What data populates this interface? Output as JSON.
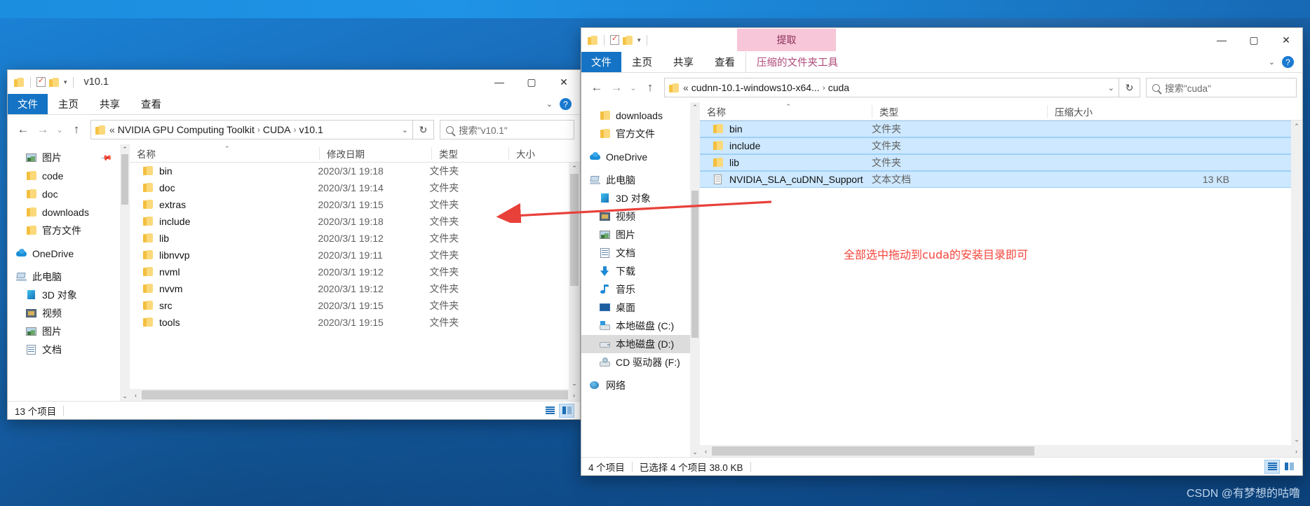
{
  "desktop": {
    "watermark": "CSDN @有梦想的咕噜",
    "annotation": "全部选中拖动到cuda的安装目录即可",
    "accent_blue": "#1473c4",
    "selection_blue": "#cde8ff",
    "annotation_red": "#f5453c",
    "contextual_tab_pink": "#f7c6d8"
  },
  "left_window": {
    "title": "v10.1",
    "quick_access": {
      "folder_icon": "folder-icon",
      "properties_icon": "properties-icon",
      "new_folder_icon": "new-folder-icon",
      "customize_caret": "▾"
    },
    "window_controls": {
      "minimize": "—",
      "maximize": "▢",
      "close": "✕"
    },
    "ribbon_tabs": [
      "文件",
      "主页",
      "共享",
      "查看"
    ],
    "ribbon_right": {
      "collapse_caret": "⌄",
      "help": "?"
    },
    "address": {
      "back": "←",
      "forward": "→",
      "recent": "⌄",
      "up": "↑",
      "folder_icon": "folder-icon",
      "chevron_prefix": "«",
      "crumbs": [
        "NVIDIA GPU Computing Toolkit",
        "CUDA",
        "v10.1"
      ],
      "crumb_sep": "›",
      "dropdown_caret": "⌄",
      "refresh": "↻"
    },
    "search": {
      "icon": "search-icon",
      "placeholder": "搜索\"v10.1\"",
      "value": ""
    },
    "nav_pane": [
      {
        "label": "图片",
        "icon": "pictures-icon",
        "indent": true,
        "pinned": true
      },
      {
        "label": "code",
        "icon": "folder-icon",
        "indent": true
      },
      {
        "label": "doc",
        "icon": "folder-icon",
        "indent": true
      },
      {
        "label": "downloads",
        "icon": "folder-icon",
        "indent": true
      },
      {
        "label": "官方文件",
        "icon": "folder-icon",
        "indent": true
      },
      {
        "label": "OneDrive",
        "icon": "onedrive-icon",
        "indent": false
      },
      {
        "label": "此电脑",
        "icon": "this-pc-icon",
        "indent": false
      },
      {
        "label": "3D 对象",
        "icon": "3d-objects-icon",
        "indent": true
      },
      {
        "label": "视频",
        "icon": "videos-icon",
        "indent": true
      },
      {
        "label": "图片",
        "icon": "pictures-icon",
        "indent": true
      },
      {
        "label": "文档",
        "icon": "documents-icon",
        "indent": true
      }
    ],
    "columns": [
      "名称",
      "修改日期",
      "类型",
      "大小"
    ],
    "rows": [
      {
        "name": "bin",
        "date": "2020/3/1 19:18",
        "type": "文件夹",
        "size": ""
      },
      {
        "name": "doc",
        "date": "2020/3/1 19:14",
        "type": "文件夹",
        "size": ""
      },
      {
        "name": "extras",
        "date": "2020/3/1 19:15",
        "type": "文件夹",
        "size": ""
      },
      {
        "name": "include",
        "date": "2020/3/1 19:18",
        "type": "文件夹",
        "size": ""
      },
      {
        "name": "lib",
        "date": "2020/3/1 19:12",
        "type": "文件夹",
        "size": ""
      },
      {
        "name": "libnvvp",
        "date": "2020/3/1 19:11",
        "type": "文件夹",
        "size": ""
      },
      {
        "name": "nvml",
        "date": "2020/3/1 19:12",
        "type": "文件夹",
        "size": ""
      },
      {
        "name": "nvvm",
        "date": "2020/3/1 19:12",
        "type": "文件夹",
        "size": ""
      },
      {
        "name": "src",
        "date": "2020/3/1 19:15",
        "type": "文件夹",
        "size": ""
      },
      {
        "name": "tools",
        "date": "2020/3/1 19:15",
        "type": "文件夹",
        "size": ""
      }
    ],
    "status": {
      "count": "13 个项目",
      "selection": ""
    },
    "view_toggles": {
      "details": "details-view-icon",
      "tiles": "tiles-view-icon",
      "active": "tiles"
    }
  },
  "right_window": {
    "title": "cuda",
    "contextual_tab_banner": "提取",
    "quick_access": {
      "folder_icon": "folder-icon",
      "properties_icon": "properties-icon",
      "new_folder_icon": "new-folder-icon",
      "customize_caret": "▾"
    },
    "window_controls": {
      "minimize": "—",
      "maximize": "▢",
      "close": "✕"
    },
    "ribbon_tabs": [
      "文件",
      "主页",
      "共享",
      "查看"
    ],
    "contextual_tab": "压缩的文件夹工具",
    "ribbon_right": {
      "collapse_caret": "⌄",
      "help": "?"
    },
    "address": {
      "back": "←",
      "forward": "→",
      "recent": "⌄",
      "up": "↑",
      "folder_icon": "folder-icon",
      "chevron_prefix": "«",
      "crumbs": [
        "cudnn-10.1-windows10-x64...",
        "cuda"
      ],
      "crumb_sep": "›",
      "dropdown_caret": "⌄",
      "refresh": "↻"
    },
    "search": {
      "icon": "search-icon",
      "placeholder": "搜索\"cuda\"",
      "value": ""
    },
    "nav_pane": [
      {
        "label": "downloads",
        "icon": "folder-icon",
        "indent": true
      },
      {
        "label": "官方文件",
        "icon": "folder-icon",
        "indent": true
      },
      {
        "label": "OneDrive",
        "icon": "onedrive-icon",
        "indent": false
      },
      {
        "label": "此电脑",
        "icon": "this-pc-icon",
        "indent": false
      },
      {
        "label": "3D 对象",
        "icon": "3d-objects-icon",
        "indent": true
      },
      {
        "label": "视频",
        "icon": "videos-icon",
        "indent": true
      },
      {
        "label": "图片",
        "icon": "pictures-icon",
        "indent": true
      },
      {
        "label": "文档",
        "icon": "documents-icon",
        "indent": true
      },
      {
        "label": "下载",
        "icon": "downloads-icon",
        "indent": true
      },
      {
        "label": "音乐",
        "icon": "music-icon",
        "indent": true
      },
      {
        "label": "桌面",
        "icon": "desktop-icon",
        "indent": true
      },
      {
        "label": "本地磁盘 (C:)",
        "icon": "windows-drive-icon",
        "indent": true
      },
      {
        "label": "本地磁盘 (D:)",
        "icon": "drive-icon",
        "indent": true,
        "selected": true
      },
      {
        "label": "CD 驱动器 (F:)",
        "icon": "cd-drive-icon",
        "indent": true
      },
      {
        "label": "网络",
        "icon": "network-icon",
        "indent": false
      }
    ],
    "columns": [
      "名称",
      "类型",
      "压缩大小"
    ],
    "rows": [
      {
        "name": "bin",
        "icon": "folder-icon",
        "type": "文件夹",
        "size": "",
        "selected": true
      },
      {
        "name": "include",
        "icon": "folder-icon",
        "type": "文件夹",
        "size": "",
        "selected": true
      },
      {
        "name": "lib",
        "icon": "folder-icon",
        "type": "文件夹",
        "size": "",
        "selected": true
      },
      {
        "name": "NVIDIA_SLA_cuDNN_Support",
        "icon": "text-file-icon",
        "type": "文本文档",
        "size": "13 KB",
        "selected": true
      }
    ],
    "status": {
      "count": "4 个项目",
      "selection": "已选择 4 个项目  38.0 KB"
    },
    "view_toggles": {
      "details": "details-view-icon",
      "tiles": "tiles-view-icon",
      "active": "details"
    }
  }
}
